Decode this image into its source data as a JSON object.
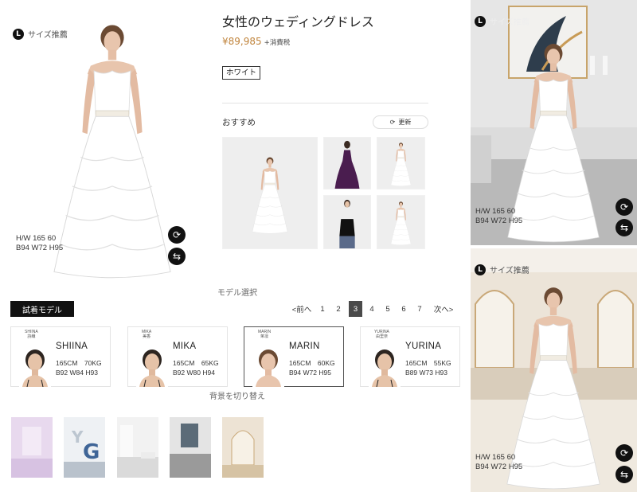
{
  "product": {
    "title": "女性のウェディングドレス",
    "price": "¥89,985",
    "tax_label": "+消費税",
    "color_option": "ホワイト"
  },
  "main_figure": {
    "size_badge_letter": "L",
    "size_badge_label": "サイズ推薦",
    "measure_line1": "H/W 165 60",
    "measure_line2": "B94 W72 H95",
    "rotate_icon": "rotate-icon",
    "swap_icon": "swap-icon"
  },
  "recommend": {
    "label": "おすすめ",
    "refresh_label": "更新"
  },
  "models": {
    "heading": "モデル選択",
    "tab_label": "試着モデル",
    "pager": {
      "prev": "<前へ",
      "pages": [
        "1",
        "2",
        "3",
        "4",
        "5",
        "6",
        "7"
      ],
      "active_page": "3",
      "next": "次へ>"
    },
    "cards": [
      {
        "tiny": "SHIINA",
        "tiny_jp": "詩織",
        "name": "SHIINA",
        "stat1": "165CM　70KG",
        "stat2": "B92 W84 H93",
        "selected": false
      },
      {
        "tiny": "MIKA",
        "tiny_jp": "美香",
        "name": "MIKA",
        "stat1": "165CM　65KG",
        "stat2": "B92 W80 H94",
        "selected": false
      },
      {
        "tiny": "MARIN",
        "tiny_jp": "茉凛",
        "name": "MARIN",
        "stat1": "165CM　60KG",
        "stat2": "B94 W72 H95",
        "selected": true
      },
      {
        "tiny": "YURINA",
        "tiny_jp": "由里奈",
        "name": "YURINA",
        "stat1": "165CM　55KG",
        "stat2": "B89 W73 H93",
        "selected": false
      }
    ]
  },
  "backgrounds": {
    "heading": "背景を切り替え"
  },
  "right_top": {
    "size_badge_letter": "L",
    "size_badge_label": "サイズ推薦",
    "measure_line1": "H/W 165 60",
    "measure_line2": "B94 W72 H95"
  },
  "right_bottom": {
    "size_badge_letter": "L",
    "size_badge_label": "サイズ推薦",
    "measure_line1": "H/W 165 60",
    "measure_line2": "B94 W72 H95"
  },
  "colors": {
    "price": "#c0843c",
    "active": "#111111",
    "dress": "#ffffff"
  }
}
